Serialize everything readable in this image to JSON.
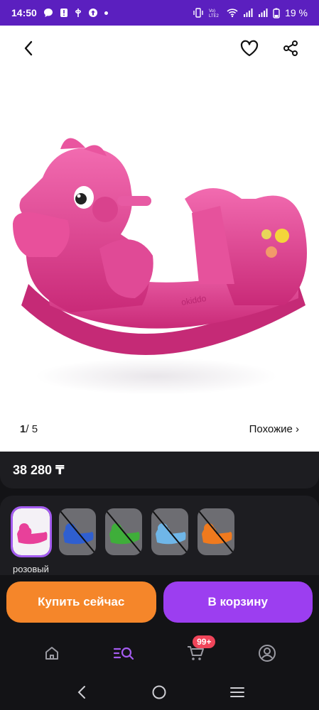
{
  "status_bar": {
    "time": "14:50",
    "battery": "19 %",
    "icons": [
      "message-icon",
      "alert-icon",
      "usb-icon",
      "upload-icon",
      "dot-icon",
      "vibrate-icon",
      "volte-icon",
      "wifi-icon",
      "signal-icon",
      "signal-icon",
      "battery-icon"
    ]
  },
  "top_nav": {
    "back_icon": "chevron-left-icon",
    "favorite_icon": "heart-icon",
    "share_icon": "share-icon"
  },
  "gallery": {
    "current": "1",
    "separator": "/ ",
    "total": "5",
    "similar": "Похожие ›",
    "brand_mark": "okiddo"
  },
  "price": "38 280 ₸",
  "variants": {
    "items": [
      {
        "color": "#e8409a",
        "available": true,
        "selected": true
      },
      {
        "color": "#2f5fd0",
        "available": false,
        "selected": false
      },
      {
        "color": "#3fae3a",
        "available": false,
        "selected": false
      },
      {
        "color": "#6fb6e8",
        "available": false,
        "selected": false
      },
      {
        "color": "#f07a1e",
        "available": false,
        "selected": false
      }
    ],
    "selected_label": "розовый"
  },
  "actions": {
    "buy_now": "Купить сейчас",
    "add_to_cart": "В корзину"
  },
  "tab_bar": {
    "items": [
      {
        "icon": "home-icon",
        "active": false
      },
      {
        "icon": "catalog-search-icon",
        "active": true
      },
      {
        "icon": "cart-icon",
        "active": false
      },
      {
        "icon": "profile-icon",
        "active": false
      }
    ],
    "cart_badge": "99+"
  },
  "colors": {
    "status_bar": "#5b1fbf",
    "accent_purple": "#9c3ef0",
    "accent_orange": "#f5862a",
    "dark_bg": "#131316",
    "panel_bg": "#1d1d21",
    "badge": "#f0455a",
    "product_pink": "#e0408f"
  }
}
